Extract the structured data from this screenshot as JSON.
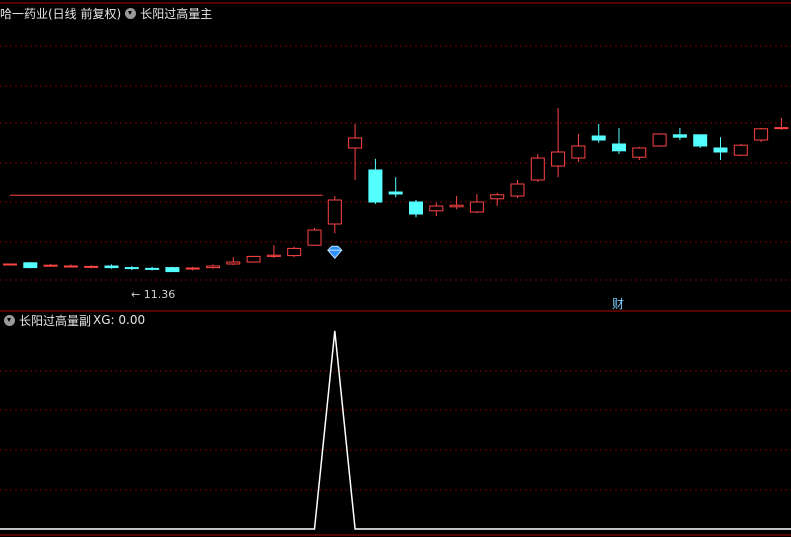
{
  "main": {
    "title": "哈一药业(日线 前复权)",
    "indicator": "长阳过高量主",
    "low_label": "← 11.36",
    "finance_badge": "财"
  },
  "sub": {
    "indicator": "长阳过高量副",
    "xg_text": "XG: 0.00"
  },
  "colors": {
    "up": "#ff4444",
    "down": "#54ffff",
    "grid": "#7a0000",
    "frame": "#b00000",
    "signal": "#ffffff"
  },
  "chart_data": [
    {
      "type": "candlestick",
      "candles": [
        {
          "o": 11.45,
          "h": 11.45,
          "l": 11.45,
          "c": 11.45
        },
        {
          "o": 11.48,
          "h": 11.5,
          "l": 11.34,
          "c": 11.36
        },
        {
          "o": 11.42,
          "h": 11.45,
          "l": 11.38,
          "c": 11.42
        },
        {
          "o": 11.4,
          "h": 11.44,
          "l": 11.38,
          "c": 11.4
        },
        {
          "o": 11.38,
          "h": 11.42,
          "l": 11.34,
          "c": 11.39
        },
        {
          "o": 11.4,
          "h": 11.44,
          "l": 11.33,
          "c": 11.36
        },
        {
          "o": 11.36,
          "h": 11.4,
          "l": 11.3,
          "c": 11.34
        },
        {
          "o": 11.34,
          "h": 11.38,
          "l": 11.29,
          "c": 11.33
        },
        {
          "o": 11.36,
          "h": 11.38,
          "l": 11.25,
          "c": 11.26
        },
        {
          "o": 11.34,
          "h": 11.38,
          "l": 11.29,
          "c": 11.35
        },
        {
          "o": 11.36,
          "h": 11.44,
          "l": 11.33,
          "c": 11.4
        },
        {
          "o": 11.45,
          "h": 11.62,
          "l": 11.42,
          "c": 11.5
        },
        {
          "o": 11.5,
          "h": 11.65,
          "l": 11.48,
          "c": 11.64
        },
        {
          "o": 11.64,
          "h": 11.92,
          "l": 11.6,
          "c": 11.67
        },
        {
          "o": 11.66,
          "h": 11.88,
          "l": 11.62,
          "c": 11.84
        },
        {
          "o": 11.92,
          "h": 12.35,
          "l": 11.9,
          "c": 12.3
        },
        {
          "o": 12.45,
          "h": 13.15,
          "l": 12.22,
          "c": 13.05
        },
        {
          "o": 14.35,
          "h": 14.95,
          "l": 13.55,
          "c": 14.6
        },
        {
          "o": 13.8,
          "h": 14.08,
          "l": 12.95,
          "c": 13.0
        },
        {
          "o": 13.25,
          "h": 13.62,
          "l": 13.12,
          "c": 13.2
        },
        {
          "o": 13.0,
          "h": 13.05,
          "l": 12.62,
          "c": 12.7
        },
        {
          "o": 12.78,
          "h": 12.98,
          "l": 12.65,
          "c": 12.9
        },
        {
          "o": 12.88,
          "h": 13.15,
          "l": 12.82,
          "c": 12.92
        },
        {
          "o": 12.75,
          "h": 13.2,
          "l": 12.72,
          "c": 13.0
        },
        {
          "o": 13.08,
          "h": 13.23,
          "l": 12.9,
          "c": 13.18
        },
        {
          "o": 13.15,
          "h": 13.55,
          "l": 13.1,
          "c": 13.45
        },
        {
          "o": 13.55,
          "h": 14.2,
          "l": 13.5,
          "c": 14.1
        },
        {
          "o": 13.9,
          "h": 15.35,
          "l": 13.62,
          "c": 14.25
        },
        {
          "o": 14.1,
          "h": 14.7,
          "l": 14.0,
          "c": 14.4
        },
        {
          "o": 14.65,
          "h": 14.95,
          "l": 14.48,
          "c": 14.55
        },
        {
          "o": 14.45,
          "h": 14.85,
          "l": 14.2,
          "c": 14.28
        },
        {
          "o": 14.12,
          "h": 14.38,
          "l": 14.05,
          "c": 14.35
        },
        {
          "o": 14.4,
          "h": 14.72,
          "l": 14.38,
          "c": 14.7
        },
        {
          "o": 14.68,
          "h": 14.85,
          "l": 14.55,
          "c": 14.62
        },
        {
          "o": 14.68,
          "h": 14.68,
          "l": 14.35,
          "c": 14.4
        },
        {
          "o": 14.35,
          "h": 14.62,
          "l": 14.05,
          "c": 14.25
        },
        {
          "o": 14.17,
          "h": 14.45,
          "l": 14.15,
          "c": 14.42
        },
        {
          "o": 14.55,
          "h": 14.85,
          "l": 14.5,
          "c": 14.83
        },
        {
          "o": 14.85,
          "h": 15.1,
          "l": 14.8,
          "c": 14.86
        },
        {
          "o": 14.9,
          "h": 15.6,
          "l": 14.82,
          "c": 15.35
        }
      ],
      "reference_line": 13.17,
      "signal_day": 16
    },
    {
      "type": "line",
      "series": [
        {
          "name": "XG",
          "values": [
            0,
            0,
            0,
            0,
            0,
            0,
            0,
            0,
            0,
            0,
            0,
            0,
            0,
            0,
            0,
            0,
            1,
            0,
            0,
            0,
            0,
            0,
            0,
            0,
            0,
            0,
            0,
            0,
            0,
            0,
            0,
            0,
            0,
            0,
            0,
            0,
            0,
            0,
            0,
            0
          ]
        }
      ]
    }
  ]
}
